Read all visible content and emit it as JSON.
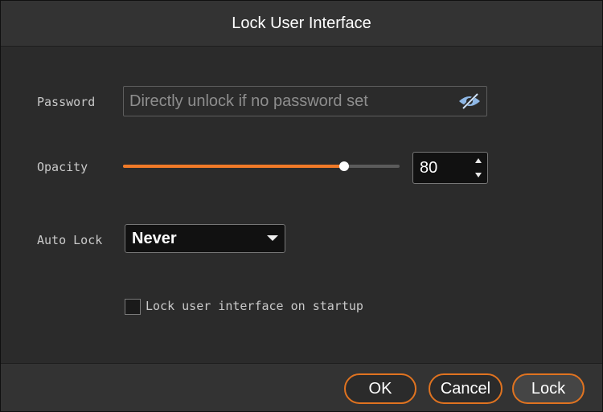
{
  "dialog": {
    "title": "Lock User Interface"
  },
  "password": {
    "label": "Password",
    "placeholder": "Directly unlock if no password set",
    "value": "",
    "toggle_icon": "eye-slash-icon"
  },
  "opacity": {
    "label": "Opacity",
    "value": "80",
    "slider_fraction": 0.8,
    "accent_color": "#f07a28"
  },
  "auto_lock": {
    "label": "Auto Lock",
    "selected": "Never"
  },
  "startup": {
    "label": "Lock user interface on startup",
    "checked": false
  },
  "buttons": {
    "ok": "OK",
    "cancel": "Cancel",
    "lock": "Lock",
    "border_color": "#e07320"
  }
}
